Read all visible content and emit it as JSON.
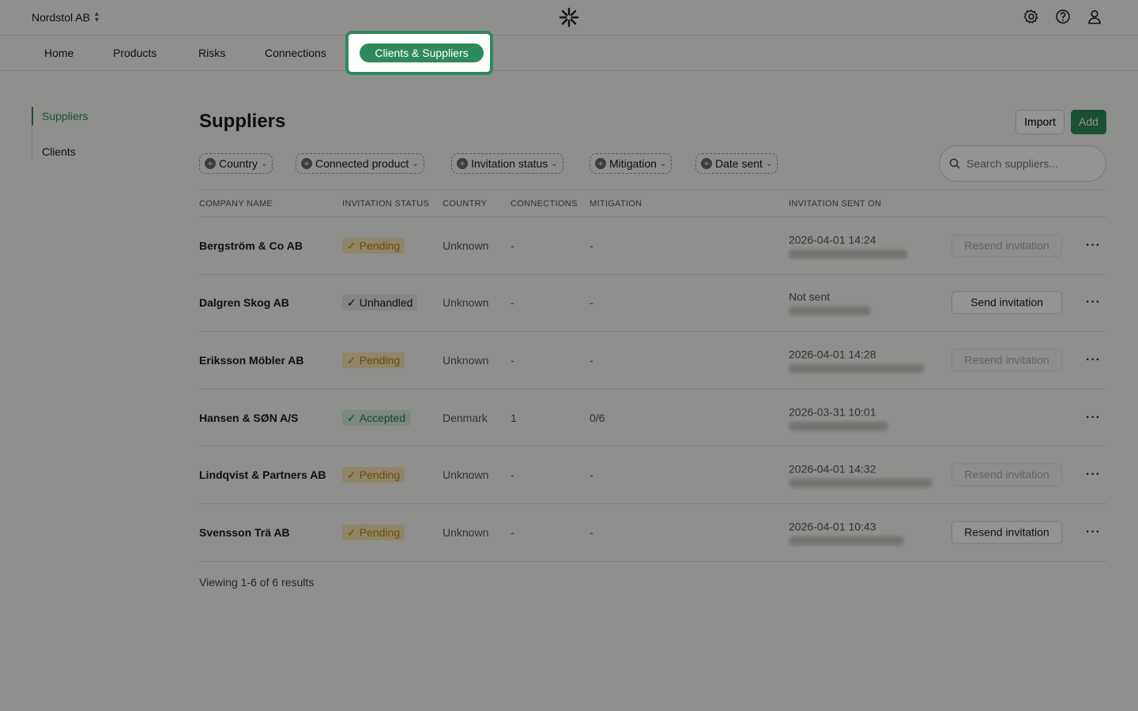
{
  "org": {
    "name": "Nordstol AB"
  },
  "top_icons": [
    "gear-icon",
    "help-icon",
    "user-icon"
  ],
  "nav": {
    "items": [
      "Home",
      "Products",
      "Risks",
      "Connections"
    ],
    "active": "Clients & Suppliers"
  },
  "sidenav": {
    "items": [
      "Suppliers",
      "Clients"
    ]
  },
  "page": {
    "title": "Suppliers",
    "import_label": "Import",
    "add_label": "Add"
  },
  "filters": [
    "Country",
    "Connected product",
    "Invitation status",
    "Mitigation",
    "Date sent"
  ],
  "search": {
    "placeholder": "Search suppliers..."
  },
  "table": {
    "headers": [
      "COMPANY NAME",
      "INVITATION STATUS",
      "COUNTRY",
      "CONNECTIONS",
      "MITIGATION",
      "INVITATION SENT ON"
    ],
    "rows": [
      {
        "company": "Bergström & Co AB",
        "status": "Pending",
        "country": "Unknown",
        "connections": "-",
        "mitigation": "-",
        "sent_on": "2026-04-01 14:24",
        "action": "Resend invitation"
      },
      {
        "company": "Dalgren Skog AB",
        "status": "Unhandled",
        "country": "Unknown",
        "connections": "-",
        "mitigation": "-",
        "sent_on": "Not sent",
        "action": "Send invitation"
      },
      {
        "company": "Eriksson Möbler AB",
        "status": "Pending",
        "country": "Unknown",
        "connections": "-",
        "mitigation": "-",
        "sent_on": "2026-04-01 14:28",
        "action": "Resend invitation"
      },
      {
        "company": "Hansen & SØN A/S",
        "status": "Accepted",
        "country": "Denmark",
        "connections": "1",
        "mitigation": "0/6",
        "sent_on": "2026-03-31 10:01",
        "action": ""
      },
      {
        "company": "Lindqvist & Partners AB",
        "status": "Pending",
        "country": "Unknown",
        "connections": "-",
        "mitigation": "-",
        "sent_on": "2026-04-01 14:32",
        "action": "Resend invitation"
      },
      {
        "company": "Svensson Trä AB",
        "status": "Pending",
        "country": "Unknown",
        "connections": "-",
        "mitigation": "-",
        "sent_on": "2026-04-01 10:43",
        "action": "Resend invitation"
      }
    ]
  },
  "footer": {
    "summary": "Viewing 1-6 of 6 results"
  },
  "colors": {
    "accent": "#2f8a5b",
    "pending": "#b8860b",
    "accepted": "#2f7a4e"
  }
}
